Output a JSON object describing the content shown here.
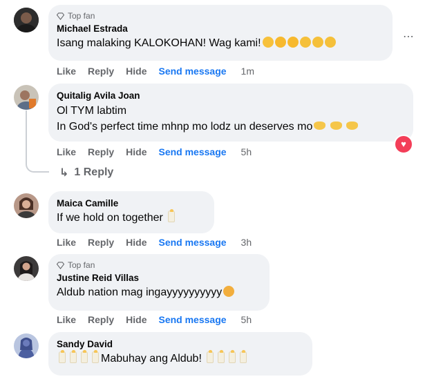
{
  "actions": {
    "like": "Like",
    "reply": "Reply",
    "hide": "Hide",
    "send": "Send message"
  },
  "comments": [
    {
      "badge": "Top fan",
      "author": "Michael Estrada",
      "text": "Isang malaking KALOKOHAN! Wag kami!",
      "time": "1m",
      "emojis": [
        "sweat",
        "rofl",
        "rofl",
        "shock",
        "shock",
        "shock"
      ]
    },
    {
      "author": "Quitalig Avila Joan",
      "line1": "Ol TYM labtim",
      "line2": "In God's perfect time mhnp mo lodz un deserves mo",
      "time": "5h",
      "reaction": "heart",
      "replies": "1 Reply"
    },
    {
      "author": "Maica Camille",
      "text": "If we hold on together",
      "time": "3h"
    },
    {
      "badge": "Top fan",
      "author": "Justine Reid Villas",
      "text": "Aldub nation mag ingayyyyyyyyyy",
      "time": "5h"
    },
    {
      "author": "Sandy David",
      "text": "Mabuhay ang Aldub!"
    }
  ],
  "more_icon": "⋯",
  "reply_arrow": "↳"
}
